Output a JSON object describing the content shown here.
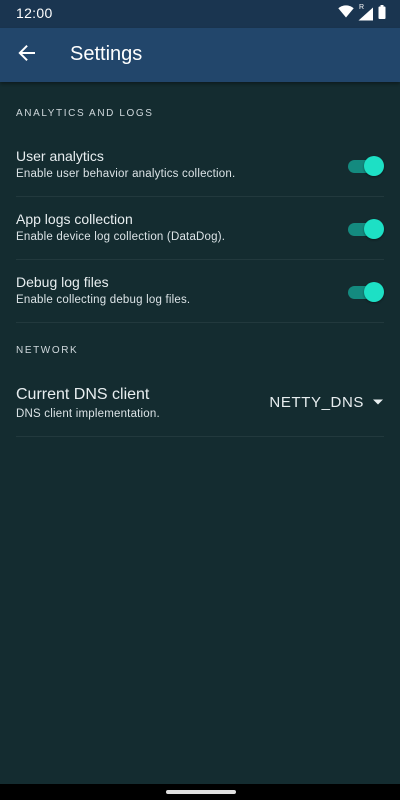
{
  "status_bar": {
    "time": "12:00",
    "icons": [
      "wifi-icon",
      "signal-icon",
      "battery-icon"
    ],
    "roaming_label": "R"
  },
  "app_bar": {
    "back_icon": "arrow-left-icon",
    "title": "Settings"
  },
  "sections": {
    "analytics": {
      "header": "ANALYTICS AND LOGS",
      "items": [
        {
          "title": "User analytics",
          "subtitle": "Enable user behavior analytics collection.",
          "enabled": true
        },
        {
          "title": "App logs collection",
          "subtitle": "Enable device log collection (DataDog).",
          "enabled": true
        },
        {
          "title": "Debug log files",
          "subtitle": "Enable collecting debug log files.",
          "enabled": true
        }
      ]
    },
    "network": {
      "header": "NETWORK",
      "dns": {
        "title": "Current DNS client",
        "subtitle": "DNS client implementation.",
        "value": "NETTY_DNS",
        "icon": "dropdown-arrow-icon"
      }
    }
  },
  "colors": {
    "background": "#142c30",
    "status_bar": "#1a3550",
    "app_bar": "#22466b",
    "toggle_thumb": "#1de0c5",
    "toggle_track": "#148a7f",
    "divider": "#22393d"
  }
}
